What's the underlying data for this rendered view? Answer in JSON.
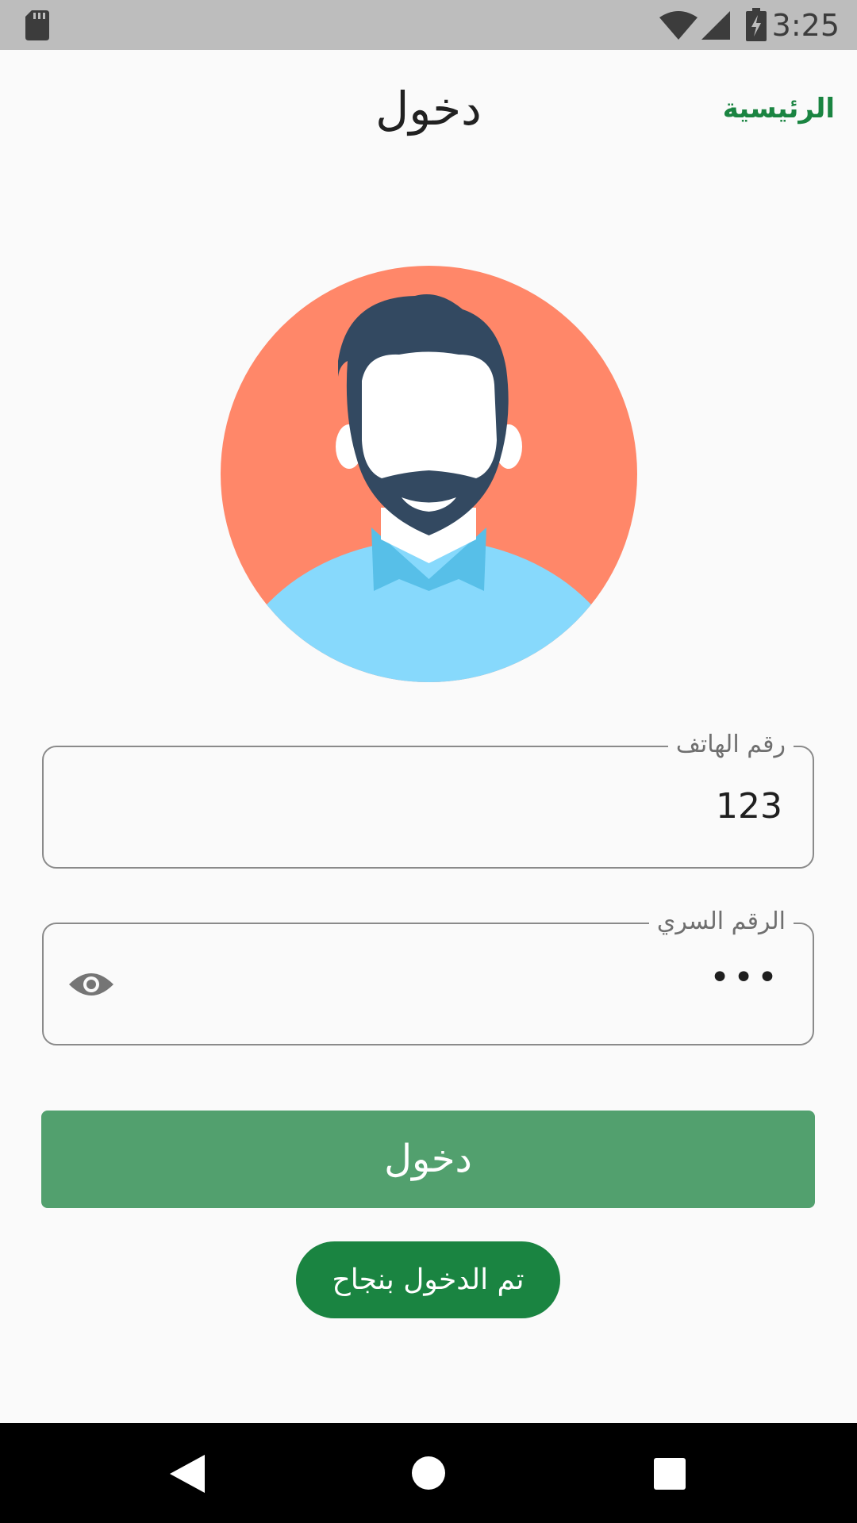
{
  "status_bar": {
    "time": "3:25",
    "icons": [
      "sd-card-icon",
      "wifi-icon",
      "cell-signal-icon",
      "battery-charging-icon"
    ]
  },
  "header": {
    "title": "دخول",
    "home_link": "الرئيسية"
  },
  "avatar": {
    "icon": "user-avatar-icon"
  },
  "form": {
    "phone": {
      "label": "رقم الهاتف",
      "value": "123"
    },
    "password": {
      "label": "الرقم السري",
      "masked_value": "•••",
      "visibility_icon": "eye-icon"
    },
    "submit_label": "دخول"
  },
  "toast": {
    "message": "تم الدخول بنجاح"
  },
  "nav_bar": {
    "icons": [
      "back-icon",
      "home-icon",
      "recents-icon"
    ]
  },
  "colors": {
    "accent_green": "#1a8441",
    "button_green": "#52a06e",
    "avatar_background": "#ff8769",
    "status_bar": "#bdbdbd"
  }
}
